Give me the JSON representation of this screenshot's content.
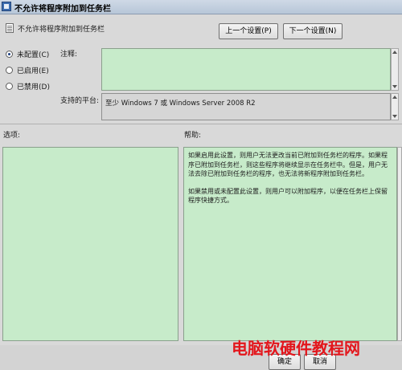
{
  "window": {
    "title": "不允许将程序附加到任务栏"
  },
  "header": {
    "policy_name": "不允许将程序附加到任务栏",
    "prev_button": "上一个设置(P)",
    "next_button": "下一个设置(N)"
  },
  "state": {
    "options": [
      {
        "label": "未配置(C)",
        "checked": true
      },
      {
        "label": "已启用(E)",
        "checked": false
      },
      {
        "label": "已禁用(D)",
        "checked": false
      }
    ]
  },
  "comment": {
    "label": "注释:",
    "value": ""
  },
  "platform": {
    "label": "支持的平台:",
    "value": "至少 Windows 7 或 Windows Server 2008 R2"
  },
  "sections": {
    "options_label": "选项:",
    "help_label": "帮助:"
  },
  "help": {
    "paragraph1": "如果启用此设置，则用户无法更改当前已附加到任务栏的程序。如果程序已附加到任务栏，则这些程序将继续显示在任务栏中。但是，用户无法去除已附加到任务栏的程序，也无法将新程序附加到任务栏。",
    "paragraph2": "如果禁用或未配置此设置，则用户可以附加程序，以便在任务栏上保留程序快捷方式。"
  },
  "footer": {
    "ok_button": "确定",
    "cancel_button": "取消"
  },
  "watermark": {
    "text": "电脑软硬件教程网"
  },
  "colors": {
    "panel_green": "#c7ebca",
    "watermark_red": "#e3161c"
  }
}
